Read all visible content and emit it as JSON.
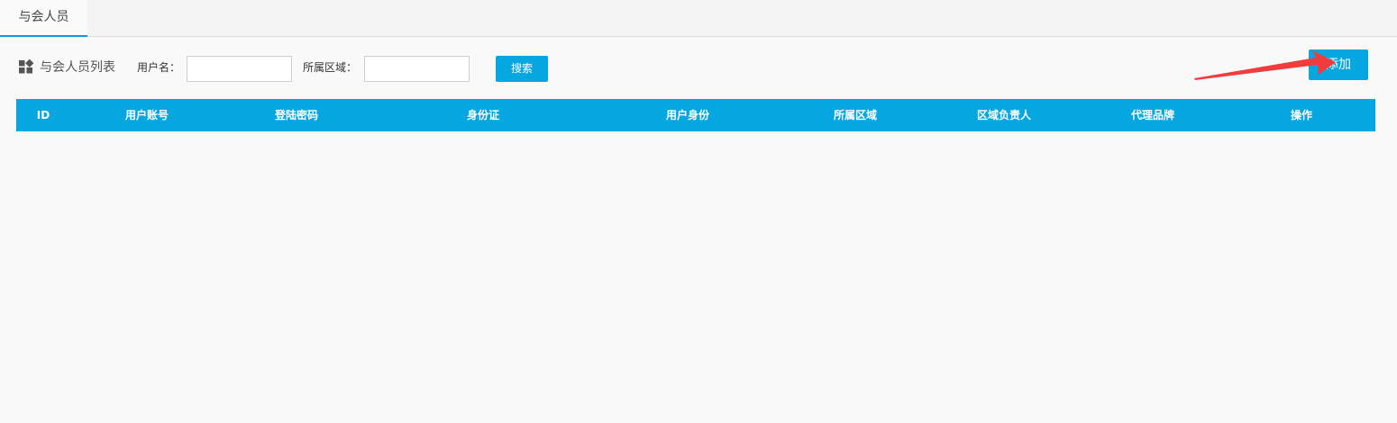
{
  "tabs": [
    {
      "label": "与会人员",
      "active": true
    }
  ],
  "toolbar": {
    "list_title": "与会人员列表",
    "username_label": "用户名：",
    "username_value": "",
    "region_label": "所属区域：",
    "region_value": "",
    "search_label": "搜索",
    "add_label": "添加"
  },
  "table": {
    "columns": [
      "ID",
      "用户账号",
      "登陆密码",
      "身份证",
      "用户身份",
      "所属区域",
      "区域负责人",
      "代理品牌",
      "操作"
    ],
    "rows": []
  },
  "colors": {
    "accent": "#06a7e1",
    "tab_underline": "#1296db",
    "annotation_arrow": "#f03c3c",
    "background": "#f9f9f9"
  },
  "icons": {
    "list_icon": "grid-icon",
    "annotation": "red-arrow-icon"
  }
}
